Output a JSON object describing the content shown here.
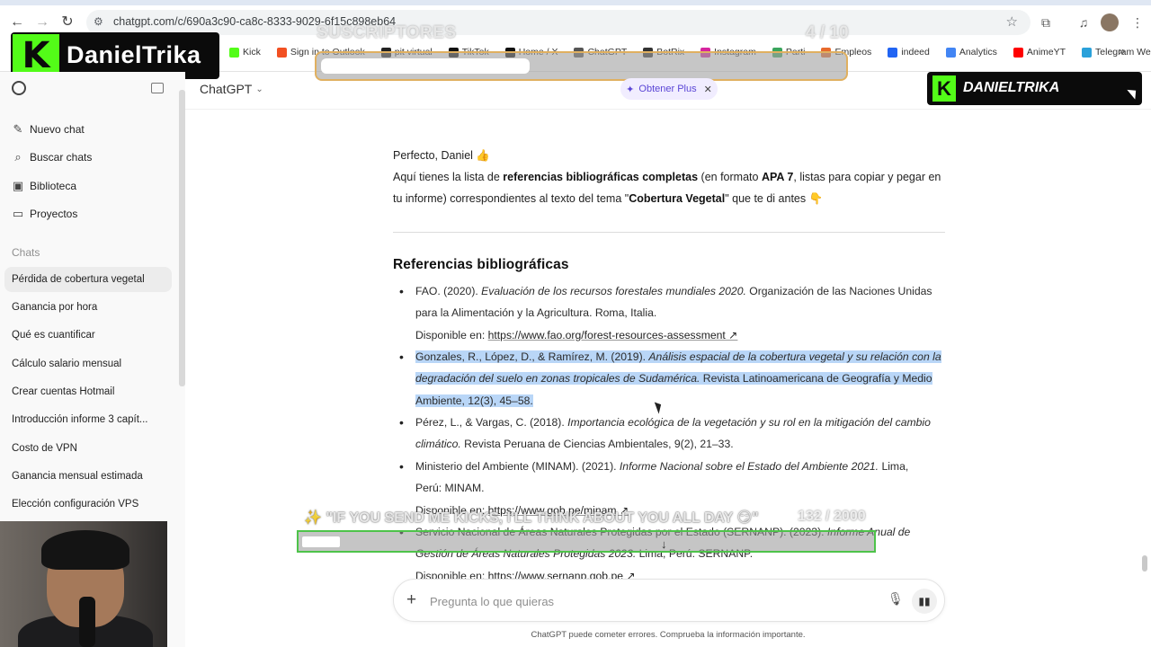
{
  "browser": {
    "url": "chatgpt.com/c/690a3c90-ca8c-8333-9029-6f15c898eb64",
    "bookmarks": [
      {
        "label": "Kick",
        "icon": "kick-icon",
        "color": "#53fc18"
      },
      {
        "label": "Sign in to Outlook",
        "icon": "microsoft-icon",
        "color": "#f25022"
      },
      {
        "label": "pit virtual",
        "icon": "pit-icon",
        "color": "#222222"
      },
      {
        "label": "TikTok",
        "icon": "tiktok-icon",
        "color": "#111111"
      },
      {
        "label": "Home / X",
        "icon": "x-icon",
        "color": "#111111"
      },
      {
        "label": "ChatGPT",
        "icon": "chatgpt-icon",
        "color": "#555555"
      },
      {
        "label": "BotRix",
        "icon": "botrix-icon",
        "color": "#333333"
      },
      {
        "label": "Instagram",
        "icon": "instagram-icon",
        "color": "#d6249f"
      },
      {
        "label": "Parti",
        "icon": "parti-icon",
        "color": "#3aa55d"
      },
      {
        "label": "Empleos",
        "icon": "empleos-icon",
        "color": "#e86a2c"
      },
      {
        "label": "indeed",
        "icon": "indeed-icon",
        "color": "#2164f3"
      },
      {
        "label": "Analytics",
        "icon": "analytics-icon",
        "color": "#4285f4"
      },
      {
        "label": "AnimeYT",
        "icon": "youtube-icon",
        "color": "#ff0000"
      },
      {
        "label": "Telegram Web",
        "icon": "telegram-icon",
        "color": "#2aa1da"
      }
    ]
  },
  "overlay": {
    "brand_name": "DanielTrika",
    "brand_logo_letter": "K",
    "brand_name_small": "DANIELTRIKA",
    "sub_goal_label": "SUSCRIPTORES",
    "sub_goal_count": "4 / 10",
    "sub_goal_progress": 0.4,
    "chat_goal_text": "✨ \"IF YOU SEND ME KICKS, I'LL THINK ABOUT YOU ALL DAY 😏\"",
    "chat_goal_count": "132 / 2000",
    "chat_goal_progress": 0.066
  },
  "sidebar": {
    "nav": [
      {
        "label": "Nuevo chat",
        "icon": "new-chat-icon"
      },
      {
        "label": "Buscar chats",
        "icon": "search-icon"
      },
      {
        "label": "Biblioteca",
        "icon": "library-icon"
      },
      {
        "label": "Proyectos",
        "icon": "folder-icon"
      }
    ],
    "section_title": "Chats",
    "chats": [
      "Pérdida de cobertura vegetal",
      "Ganancia por hora",
      "Qué es cuantificar",
      "Cálculo salario mensual",
      "Crear cuentas Hotmail",
      "Introducción informe 3 capít...",
      "Costo de VPN",
      "Ganancia mensual estimada",
      "Elección configuración VPS"
    ]
  },
  "header": {
    "model": "ChatGPT",
    "upgrade_label": "Obtener Plus",
    "upgrade_icon": "sparkle-icon"
  },
  "message": {
    "greeting": "Perfecto, Daniel 👍",
    "intro_1": "Aquí tienes la lista de ",
    "intro_bold_1": "referencias bibliográficas completas",
    "intro_2": " (en formato ",
    "intro_bold_2": "APA 7",
    "intro_3": ", listas para copiar y pegar en",
    "intro_line2_a": "tu informe) correspondientes al texto del tema \"",
    "intro_line2_bold": "Cobertura Vegetal",
    "intro_line2_b": "\" que te di antes 👇",
    "heading": "Referencias bibliográficas",
    "refs": {
      "r1_a": "FAO. (2020). ",
      "r1_it": "Evaluación de los recursos forestales mundiales 2020.",
      "r1_b": " Organización de las Naciones Unidas",
      "r1_line2": "para la Alimentación y la Agricultura. Roma, Italia.",
      "r1_avail": "Disponible en: ",
      "r1_link": "https://www.fao.org/forest-resources-assessment ↗",
      "r2_a": "Gonzales, R., López, D., & Ramírez, M. (2019). ",
      "r2_it1": "Análisis espacial de la cobertura vegetal y su relación con la",
      "r2_it2": "degradación del suelo en zonas tropicales de Sudamérica.",
      "r2_b": " Revista Latinoamericana de Geografía y Medio",
      "r2_line3": "Ambiente, 12(3), 45–58.",
      "r3_a": "Pérez, L., & Vargas, C. (2018). ",
      "r3_it1": "Importancia ecológica de la vegetación y su rol en la mitigación del cambio",
      "r3_it2": "climático.",
      "r3_b": " Revista Peruana de Ciencias Ambientales, 9(2), 21–33.",
      "r4_a": "Ministerio del Ambiente (MINAM). (2021). ",
      "r4_it": "Informe Nacional sobre el Estado del Ambiente 2021.",
      "r4_b": " Lima,",
      "r4_line2": "Perú: MINAM.",
      "r4_avail": "Disponible en: ",
      "r4_link": "https://www.gob.pe/minam ↗",
      "r5_a": "Servicio Nacional de Áreas Naturales Protegidas por el Estado (SERNANP). (2023). ",
      "r5_it1": "Informe Anual de",
      "r5_it2": "Gestión de Áreas Naturales Protegidas 2023.",
      "r5_b": " Lima, Perú: SERNANP.",
      "r5_avail": "Disponible en: ",
      "r5_link": "https://www.sernanp.gob.pe ↗"
    }
  },
  "composer": {
    "placeholder": "Pregunta lo que quieras",
    "disclaimer": "ChatGPT puede cometer errores. Comprueba la información importante."
  }
}
